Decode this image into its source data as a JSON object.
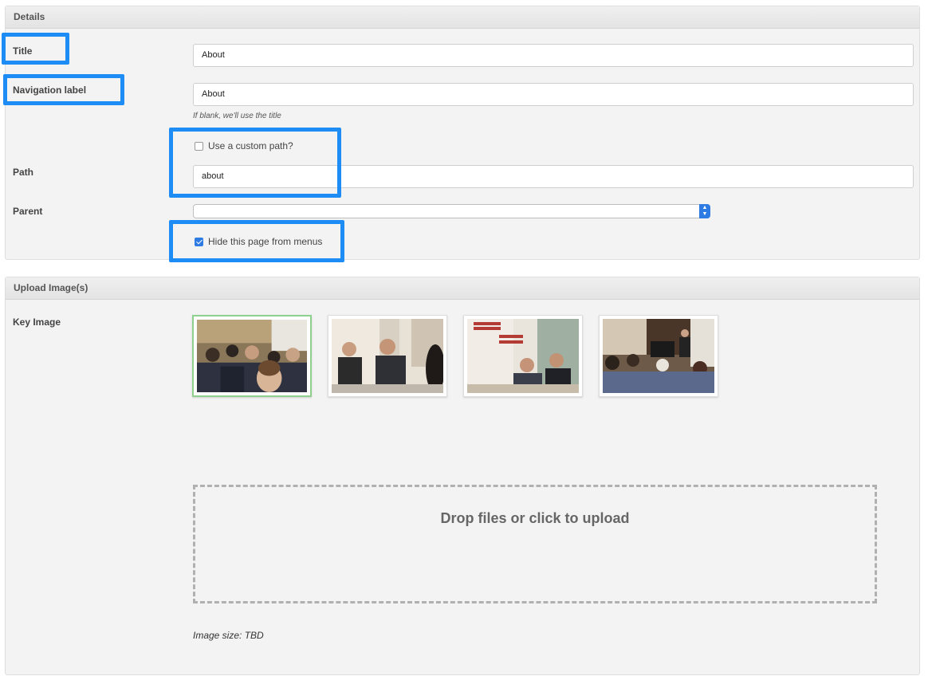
{
  "details": {
    "header": "Details",
    "title_label": "Title",
    "title_value": "About",
    "nav_label": "Navigation label",
    "nav_value": "About",
    "nav_help": "If blank, we'll use the title",
    "custom_path_label": "Use a custom path?",
    "custom_path_checked": false,
    "path_label": "Path",
    "path_value": "about",
    "parent_label": "Parent",
    "parent_value": "",
    "hide_label": "Hide this page from menus",
    "hide_checked": true
  },
  "upload": {
    "header": "Upload Image(s)",
    "key_image_label": "Key Image",
    "thumbnails": [
      "photo-audience",
      "photo-panel-discussion",
      "photo-human-rights-banner",
      "photo-lecture-room"
    ],
    "selected_thumbnail": 0,
    "dropzone_text": "Drop files or click to upload",
    "image_size_note": "Image size: TBD"
  },
  "colors": {
    "highlight": "#1e8cf5",
    "checkbox_accent": "#2d7be3",
    "selected_thumb_border": "#8fd08f"
  }
}
